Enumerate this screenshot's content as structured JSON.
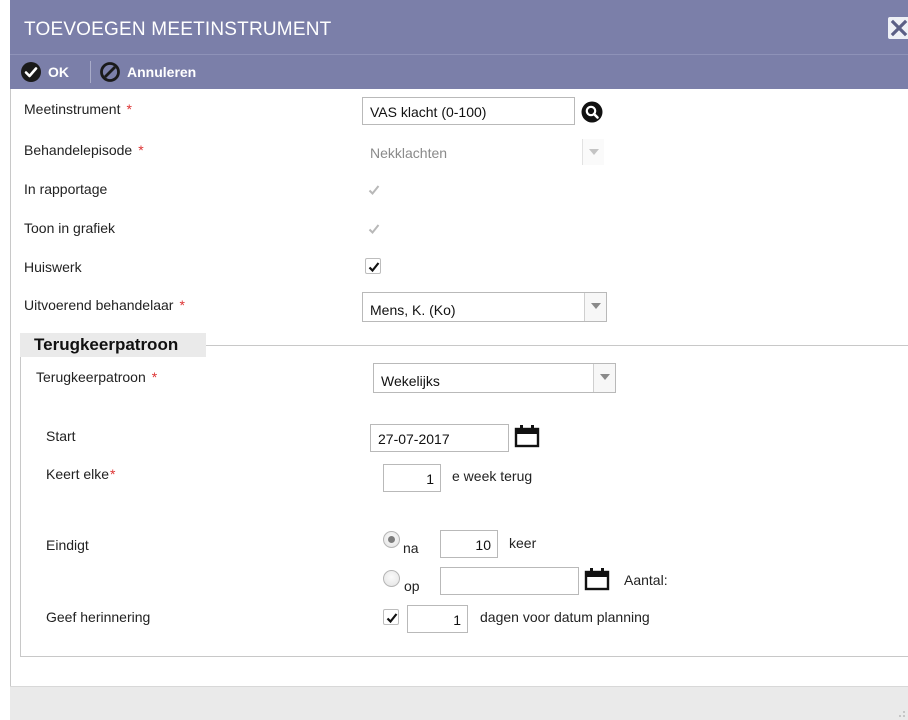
{
  "dialog": {
    "title": "TOEVOEGEN MEETINSTRUMENT"
  },
  "toolbar": {
    "ok_label": "OK",
    "cancel_label": "Annuleren"
  },
  "form": {
    "meetinstrument": {
      "label": "Meetinstrument",
      "required": "*",
      "value": "VAS klacht (0-100)"
    },
    "behandelepisode": {
      "label": "Behandelepisode",
      "required": "*",
      "value": "Nekklachten"
    },
    "in_rapportage": {
      "label": "In rapportage",
      "checked": true,
      "disabled": true
    },
    "toon_in_grafiek": {
      "label": "Toon in grafiek",
      "checked": true,
      "disabled": true
    },
    "huiswerk": {
      "label": "Huiswerk",
      "checked": true
    },
    "behandelaar": {
      "label": "Uitvoerend behandelaar",
      "required": "*",
      "value": "Mens, K. (Ko)"
    }
  },
  "recurrence": {
    "legend": "Terugkeerpatroon",
    "pattern": {
      "label": "Terugkeerpatroon",
      "required": "*",
      "value": "Wekelijks"
    },
    "start": {
      "label": "Start",
      "value": "27-07-2017"
    },
    "repeat": {
      "label": "Keert elke",
      "required": "*",
      "value": "1",
      "suffix": "e week terug"
    },
    "ends": {
      "label": "Eindigt",
      "after_label": "na",
      "after_value": "10",
      "after_suffix": "keer",
      "on_label": "op",
      "on_value": "",
      "count_label": "Aantal:",
      "selected": "na"
    },
    "reminder": {
      "label": "Geef herinnering",
      "checked": true,
      "value": "1",
      "suffix": "dagen voor datum planning"
    }
  }
}
